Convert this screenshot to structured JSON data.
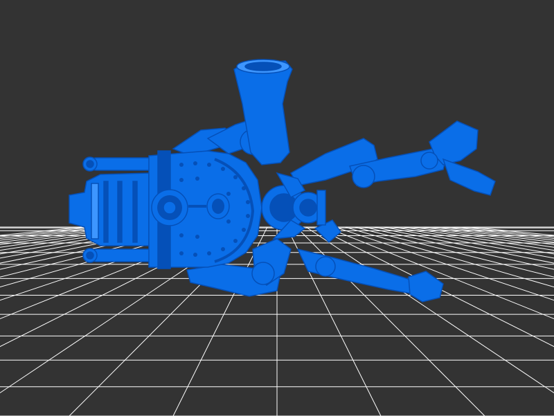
{
  "scene": {
    "background_color": "#333333",
    "grid_color": "#ffffff",
    "model_color": "#0a6ee8",
    "model_shadow_color": "#0550b8",
    "model_highlight_color": "#3d96ff",
    "model_name": "steampunk-mech-walker"
  }
}
